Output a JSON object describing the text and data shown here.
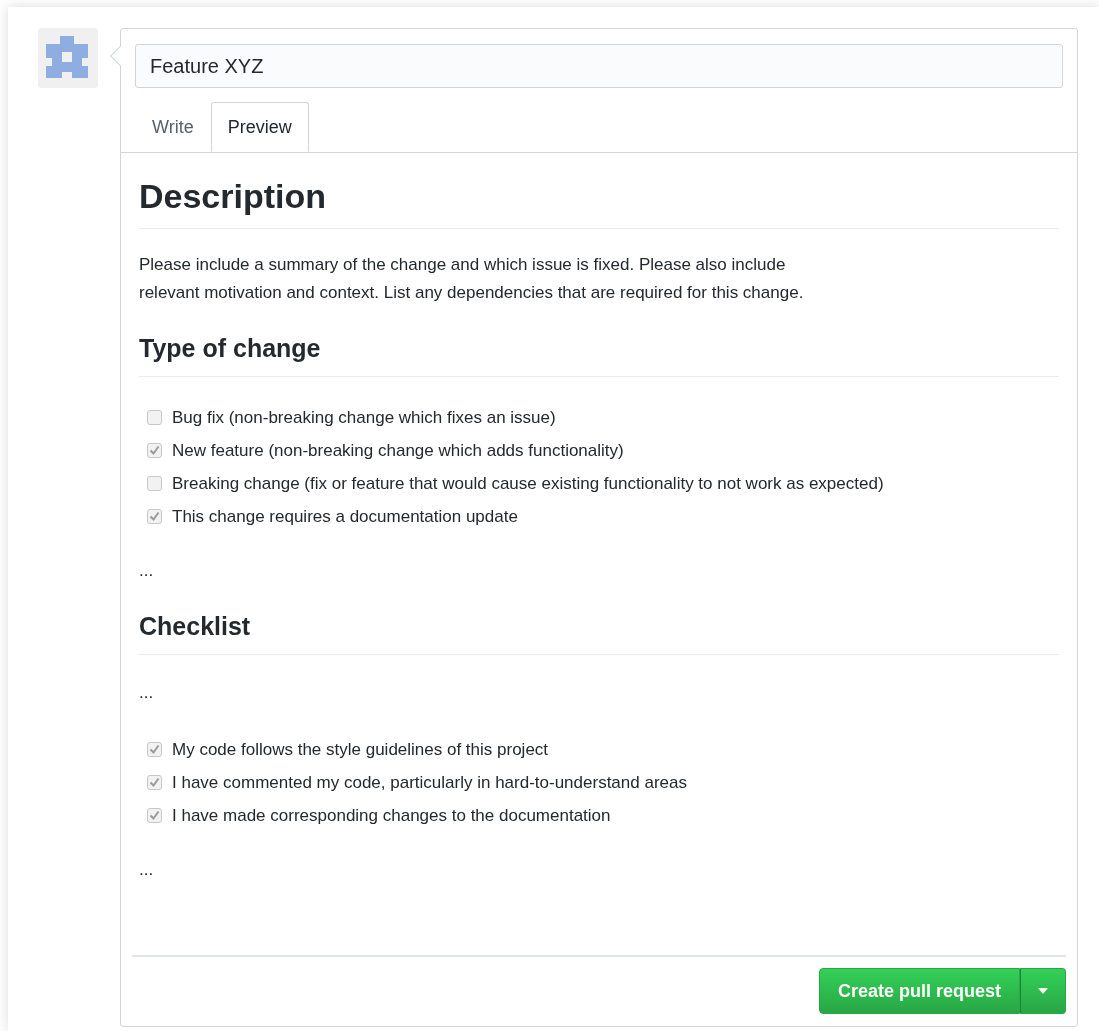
{
  "title_field": {
    "value": "Feature XYZ"
  },
  "tabs": [
    {
      "label": "Write",
      "selected": false
    },
    {
      "label": "Preview",
      "selected": true
    }
  ],
  "preview": [
    {
      "kind": "title",
      "text": "Description"
    },
    {
      "kind": "paragraph",
      "lines": [
        "Please include a summary of the change and which issue is fixed. Please also include",
        "relevant motivation and context. List any dependencies that are required for this change."
      ]
    },
    {
      "kind": "heading",
      "text": "Type of change"
    },
    {
      "kind": "checklist",
      "items": [
        {
          "label": "Bug fix (non-breaking change which fixes an issue)",
          "checked": false
        },
        {
          "label": "New feature (non-breaking change which adds functionality)",
          "checked": true
        },
        {
          "label": "Breaking change (fix or feature that would cause existing functionality to not work as expected)",
          "checked": false
        },
        {
          "label": "This change requires a documentation update",
          "checked": true
        }
      ]
    },
    {
      "kind": "paragraph",
      "lines": [
        "..."
      ]
    },
    {
      "kind": "heading",
      "text": "Checklist"
    },
    {
      "kind": "paragraph",
      "lines": [
        "..."
      ]
    },
    {
      "kind": "checklist",
      "items": [
        {
          "label": "My code follows the style guidelines of this project",
          "checked": true
        },
        {
          "label": "I have commented my code, particularly in hard-to-understand areas",
          "checked": true
        },
        {
          "label": "I have made corresponding changes to the documentation",
          "checked": true
        }
      ]
    },
    {
      "kind": "paragraph",
      "lines": [
        "..."
      ]
    }
  ],
  "submit_button": {
    "label": "Create pull request"
  }
}
